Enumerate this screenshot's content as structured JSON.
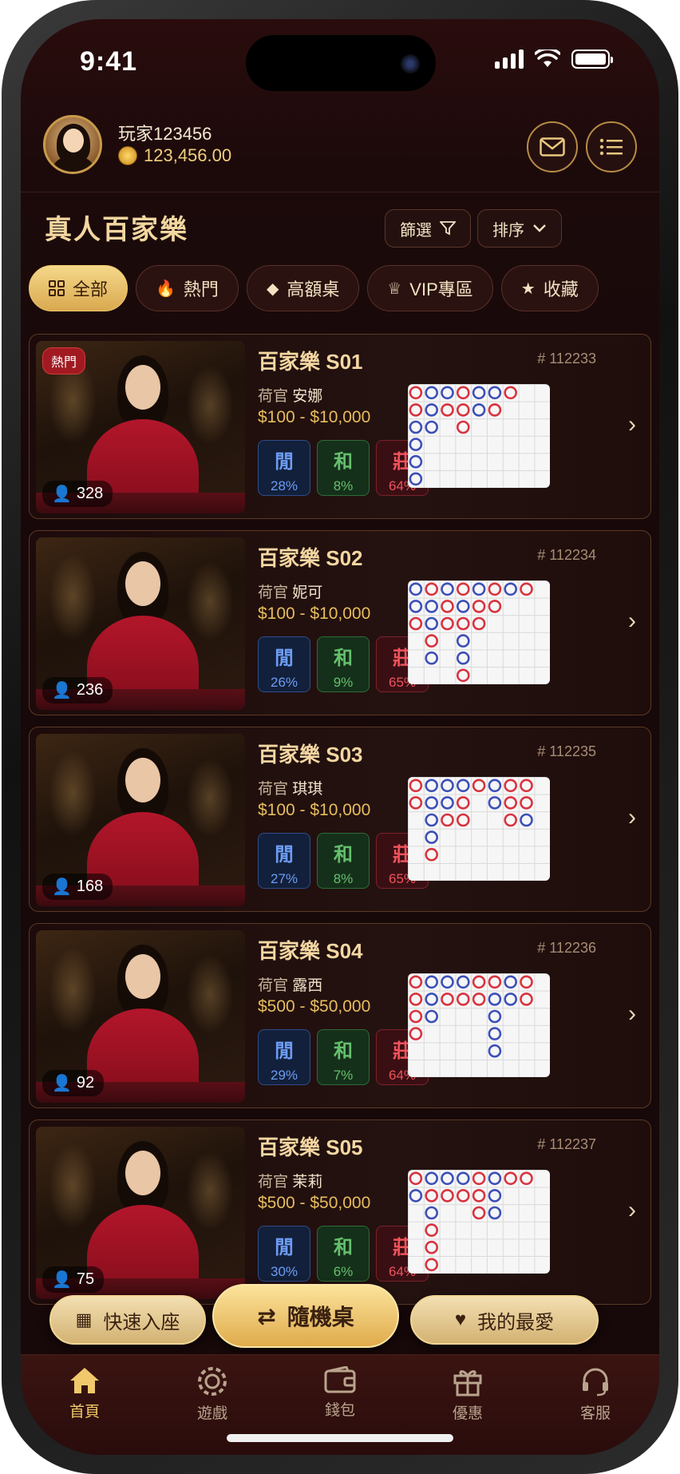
{
  "status": {
    "time": "9:41"
  },
  "user": {
    "name": "玩家123456",
    "balance": "123,456.00"
  },
  "page": {
    "title": "真人百家樂",
    "filter_label": "篩選",
    "sort_label": "排序"
  },
  "tabs": [
    {
      "label": "全部",
      "icon": "grid-icon",
      "active": true
    },
    {
      "label": "熱門",
      "icon": "flame-icon"
    },
    {
      "label": "高額桌",
      "icon": "diamond-icon"
    },
    {
      "label": "VIP專區",
      "icon": "crown-icon"
    },
    {
      "label": "收藏",
      "icon": "star-icon"
    }
  ],
  "tables": [
    {
      "name": "百家樂 S01",
      "id": "# 112233",
      "dealer_prefix": "荷官",
      "dealer": "安娜",
      "limit": "$100 - $10,000",
      "viewers": "328",
      "badge": "熱門",
      "player_label": "閒",
      "player_pct": "28%",
      "tie_label": "和",
      "tie_pct": "8%",
      "banker_label": "莊",
      "banker_pct": "64%",
      "road": [
        [
          "R",
          "B",
          "B",
          "R",
          "B",
          "B",
          "R"
        ],
        [
          "R",
          "B",
          "R",
          "R",
          "B",
          "R"
        ],
        [
          "B",
          "B",
          "",
          "R"
        ],
        [
          "B"
        ],
        [
          "B"
        ],
        [
          "B"
        ]
      ]
    },
    {
      "name": "百家樂 S02",
      "id": "# 112234",
      "dealer_prefix": "荷官",
      "dealer": "妮可",
      "limit": "$100 - $10,000",
      "viewers": "236",
      "player_label": "閒",
      "player_pct": "26%",
      "tie_label": "和",
      "tie_pct": "9%",
      "banker_label": "莊",
      "banker_pct": "65%",
      "road": [
        [
          "B",
          "R",
          "B",
          "R",
          "B",
          "R",
          "B",
          "R"
        ],
        [
          "B",
          "B",
          "R",
          "B",
          "R",
          "R"
        ],
        [
          "R",
          "B",
          "R",
          "R",
          "R"
        ],
        [
          "",
          "R",
          "",
          "B"
        ],
        [
          "",
          "B",
          "",
          "B"
        ],
        [
          "",
          "",
          "",
          "R"
        ]
      ]
    },
    {
      "name": "百家樂 S03",
      "id": "# 112235",
      "dealer_prefix": "荷官",
      "dealer": "琪琪",
      "limit": "$100 - $10,000",
      "viewers": "168",
      "player_label": "閒",
      "player_pct": "27%",
      "tie_label": "和",
      "tie_pct": "8%",
      "banker_label": "莊",
      "banker_pct": "65%",
      "road": [
        [
          "R",
          "B",
          "B",
          "B",
          "R",
          "B",
          "R",
          "R"
        ],
        [
          "R",
          "B",
          "B",
          "R",
          "",
          "B",
          "R",
          "R"
        ],
        [
          "",
          "B",
          "R",
          "R",
          "",
          "",
          "R",
          "B"
        ],
        [
          "",
          "B"
        ],
        [
          "",
          "R"
        ]
      ]
    },
    {
      "name": "百家樂 S04",
      "id": "# 112236",
      "dealer_prefix": "荷官",
      "dealer": "露西",
      "limit": "$500 - $50,000",
      "viewers": "92",
      "player_label": "閒",
      "player_pct": "29%",
      "tie_label": "和",
      "tie_pct": "7%",
      "banker_label": "莊",
      "banker_pct": "64%",
      "road": [
        [
          "R",
          "B",
          "B",
          "B",
          "R",
          "R",
          "B",
          "R"
        ],
        [
          "R",
          "B",
          "R",
          "R",
          "R",
          "B",
          "B",
          "R"
        ],
        [
          "R",
          "B",
          "",
          "",
          "",
          "B"
        ],
        [
          "R",
          "",
          "",
          "",
          "",
          "B"
        ],
        [
          "",
          "",
          "",
          "",
          "",
          "B"
        ]
      ]
    },
    {
      "name": "百家樂 S05",
      "id": "# 112237",
      "dealer_prefix": "荷官",
      "dealer": "茉莉",
      "limit": "$500 - $50,000",
      "viewers": "75",
      "player_label": "閒",
      "player_pct": "30%",
      "tie_label": "和",
      "tie_pct": "6%",
      "banker_label": "莊",
      "banker_pct": "64%",
      "road": [
        [
          "R",
          "B",
          "B",
          "B",
          "R",
          "B",
          "R",
          "R"
        ],
        [
          "B",
          "R",
          "R",
          "R",
          "R",
          "B"
        ],
        [
          "",
          "B",
          "",
          "",
          "R",
          "B"
        ],
        [
          "",
          "R"
        ],
        [
          "",
          "R"
        ],
        [
          "",
          "R"
        ]
      ]
    }
  ],
  "actions": {
    "quick_seat": "快速入座",
    "random_table": "隨機桌",
    "favorites": "我的最愛"
  },
  "nav": [
    {
      "label": "首頁",
      "icon": "home-icon",
      "active": true
    },
    {
      "label": "遊戲",
      "icon": "chip-icon"
    },
    {
      "label": "錢包",
      "icon": "wallet-icon"
    },
    {
      "label": "優惠",
      "icon": "gift-icon"
    },
    {
      "label": "客服",
      "icon": "headset-icon"
    }
  ],
  "colors": {
    "accent_gold": "#f1c86b",
    "player_blue": "#6d9cf5",
    "banker_red": "#f0535c",
    "tie_green": "#64c06d"
  }
}
